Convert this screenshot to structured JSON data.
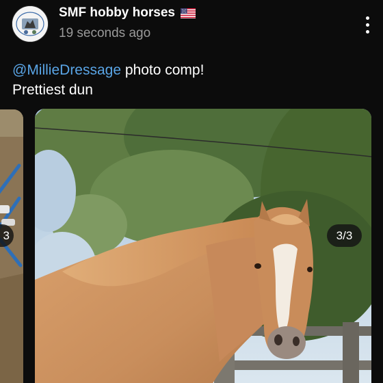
{
  "post": {
    "account_name": "SMF hobby horses",
    "flag_emoji": "🇺🇸",
    "timestamp": "19 seconds ago",
    "caption_mention": "@MillieDressage",
    "caption_line1_rest": " photo comp!",
    "caption_line2": "Prettiest dun"
  },
  "carousel": {
    "counter": "3/3",
    "prev_counter": "3"
  },
  "colors": {
    "background": "#0c0c0c",
    "mention": "#5aa5e6",
    "secondary_text": "#9a9a9a"
  },
  "icons": [
    "more-options-icon",
    "us-flag-icon"
  ]
}
